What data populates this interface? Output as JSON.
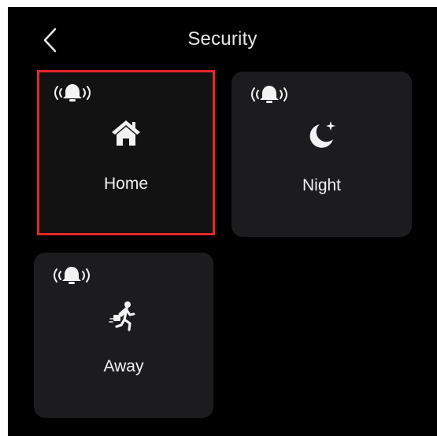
{
  "header": {
    "title": "Security"
  },
  "colors": {
    "background": "#000000",
    "tile": "#1c1c1e",
    "selected_border": "#e5262b",
    "text": "#f2f2f2"
  },
  "modes": [
    {
      "label": "Home",
      "icon": "home-icon",
      "status_icon": "alarm-bell-icon",
      "selected": true
    },
    {
      "label": "Night",
      "icon": "moon-star-icon",
      "status_icon": "alarm-bell-icon",
      "selected": false
    },
    {
      "label": "Away",
      "icon": "running-person-icon",
      "status_icon": "alarm-bell-icon",
      "selected": false
    }
  ]
}
